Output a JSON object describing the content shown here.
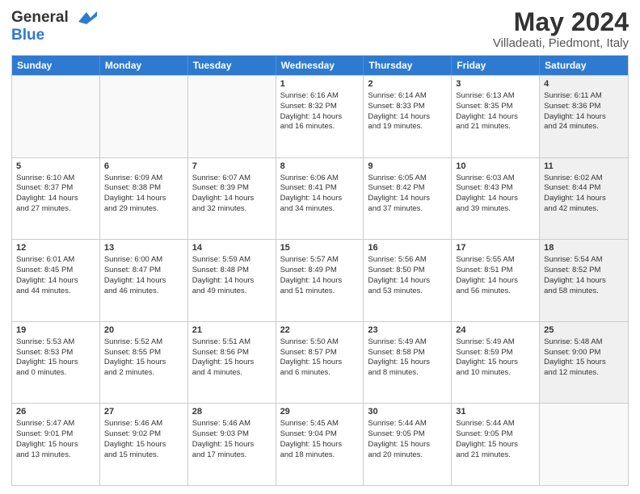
{
  "header": {
    "logo_line1": "General",
    "logo_line2": "Blue",
    "title": "May 2024",
    "subtitle": "Villadeati, Piedmont, Italy"
  },
  "calendar": {
    "days": [
      "Sunday",
      "Monday",
      "Tuesday",
      "Wednesday",
      "Thursday",
      "Friday",
      "Saturday"
    ],
    "rows": [
      [
        {
          "num": "",
          "lines": [],
          "empty": true
        },
        {
          "num": "",
          "lines": [],
          "empty": true
        },
        {
          "num": "",
          "lines": [],
          "empty": true
        },
        {
          "num": "1",
          "lines": [
            "Sunrise: 6:16 AM",
            "Sunset: 8:32 PM",
            "Daylight: 14 hours",
            "and 16 minutes."
          ],
          "shaded": false
        },
        {
          "num": "2",
          "lines": [
            "Sunrise: 6:14 AM",
            "Sunset: 8:33 PM",
            "Daylight: 14 hours",
            "and 19 minutes."
          ],
          "shaded": false
        },
        {
          "num": "3",
          "lines": [
            "Sunrise: 6:13 AM",
            "Sunset: 8:35 PM",
            "Daylight: 14 hours",
            "and 21 minutes."
          ],
          "shaded": false
        },
        {
          "num": "4",
          "lines": [
            "Sunrise: 6:11 AM",
            "Sunset: 8:36 PM",
            "Daylight: 14 hours",
            "and 24 minutes."
          ],
          "shaded": true
        }
      ],
      [
        {
          "num": "5",
          "lines": [
            "Sunrise: 6:10 AM",
            "Sunset: 8:37 PM",
            "Daylight: 14 hours",
            "and 27 minutes."
          ],
          "shaded": false
        },
        {
          "num": "6",
          "lines": [
            "Sunrise: 6:09 AM",
            "Sunset: 8:38 PM",
            "Daylight: 14 hours",
            "and 29 minutes."
          ],
          "shaded": false
        },
        {
          "num": "7",
          "lines": [
            "Sunrise: 6:07 AM",
            "Sunset: 8:39 PM",
            "Daylight: 14 hours",
            "and 32 minutes."
          ],
          "shaded": false
        },
        {
          "num": "8",
          "lines": [
            "Sunrise: 6:06 AM",
            "Sunset: 8:41 PM",
            "Daylight: 14 hours",
            "and 34 minutes."
          ],
          "shaded": false
        },
        {
          "num": "9",
          "lines": [
            "Sunrise: 6:05 AM",
            "Sunset: 8:42 PM",
            "Daylight: 14 hours",
            "and 37 minutes."
          ],
          "shaded": false
        },
        {
          "num": "10",
          "lines": [
            "Sunrise: 6:03 AM",
            "Sunset: 8:43 PM",
            "Daylight: 14 hours",
            "and 39 minutes."
          ],
          "shaded": false
        },
        {
          "num": "11",
          "lines": [
            "Sunrise: 6:02 AM",
            "Sunset: 8:44 PM",
            "Daylight: 14 hours",
            "and 42 minutes."
          ],
          "shaded": true
        }
      ],
      [
        {
          "num": "12",
          "lines": [
            "Sunrise: 6:01 AM",
            "Sunset: 8:45 PM",
            "Daylight: 14 hours",
            "and 44 minutes."
          ],
          "shaded": false
        },
        {
          "num": "13",
          "lines": [
            "Sunrise: 6:00 AM",
            "Sunset: 8:47 PM",
            "Daylight: 14 hours",
            "and 46 minutes."
          ],
          "shaded": false
        },
        {
          "num": "14",
          "lines": [
            "Sunrise: 5:59 AM",
            "Sunset: 8:48 PM",
            "Daylight: 14 hours",
            "and 49 minutes."
          ],
          "shaded": false
        },
        {
          "num": "15",
          "lines": [
            "Sunrise: 5:57 AM",
            "Sunset: 8:49 PM",
            "Daylight: 14 hours",
            "and 51 minutes."
          ],
          "shaded": false
        },
        {
          "num": "16",
          "lines": [
            "Sunrise: 5:56 AM",
            "Sunset: 8:50 PM",
            "Daylight: 14 hours",
            "and 53 minutes."
          ],
          "shaded": false
        },
        {
          "num": "17",
          "lines": [
            "Sunrise: 5:55 AM",
            "Sunset: 8:51 PM",
            "Daylight: 14 hours",
            "and 56 minutes."
          ],
          "shaded": false
        },
        {
          "num": "18",
          "lines": [
            "Sunrise: 5:54 AM",
            "Sunset: 8:52 PM",
            "Daylight: 14 hours",
            "and 58 minutes."
          ],
          "shaded": true
        }
      ],
      [
        {
          "num": "19",
          "lines": [
            "Sunrise: 5:53 AM",
            "Sunset: 8:53 PM",
            "Daylight: 15 hours",
            "and 0 minutes."
          ],
          "shaded": false
        },
        {
          "num": "20",
          "lines": [
            "Sunrise: 5:52 AM",
            "Sunset: 8:55 PM",
            "Daylight: 15 hours",
            "and 2 minutes."
          ],
          "shaded": false
        },
        {
          "num": "21",
          "lines": [
            "Sunrise: 5:51 AM",
            "Sunset: 8:56 PM",
            "Daylight: 15 hours",
            "and 4 minutes."
          ],
          "shaded": false
        },
        {
          "num": "22",
          "lines": [
            "Sunrise: 5:50 AM",
            "Sunset: 8:57 PM",
            "Daylight: 15 hours",
            "and 6 minutes."
          ],
          "shaded": false
        },
        {
          "num": "23",
          "lines": [
            "Sunrise: 5:49 AM",
            "Sunset: 8:58 PM",
            "Daylight: 15 hours",
            "and 8 minutes."
          ],
          "shaded": false
        },
        {
          "num": "24",
          "lines": [
            "Sunrise: 5:49 AM",
            "Sunset: 8:59 PM",
            "Daylight: 15 hours",
            "and 10 minutes."
          ],
          "shaded": false
        },
        {
          "num": "25",
          "lines": [
            "Sunrise: 5:48 AM",
            "Sunset: 9:00 PM",
            "Daylight: 15 hours",
            "and 12 minutes."
          ],
          "shaded": true
        }
      ],
      [
        {
          "num": "26",
          "lines": [
            "Sunrise: 5:47 AM",
            "Sunset: 9:01 PM",
            "Daylight: 15 hours",
            "and 13 minutes."
          ],
          "shaded": false
        },
        {
          "num": "27",
          "lines": [
            "Sunrise: 5:46 AM",
            "Sunset: 9:02 PM",
            "Daylight: 15 hours",
            "and 15 minutes."
          ],
          "shaded": false
        },
        {
          "num": "28",
          "lines": [
            "Sunrise: 5:46 AM",
            "Sunset: 9:03 PM",
            "Daylight: 15 hours",
            "and 17 minutes."
          ],
          "shaded": false
        },
        {
          "num": "29",
          "lines": [
            "Sunrise: 5:45 AM",
            "Sunset: 9:04 PM",
            "Daylight: 15 hours",
            "and 18 minutes."
          ],
          "shaded": false
        },
        {
          "num": "30",
          "lines": [
            "Sunrise: 5:44 AM",
            "Sunset: 9:05 PM",
            "Daylight: 15 hours",
            "and 20 minutes."
          ],
          "shaded": false
        },
        {
          "num": "31",
          "lines": [
            "Sunrise: 5:44 AM",
            "Sunset: 9:05 PM",
            "Daylight: 15 hours",
            "and 21 minutes."
          ],
          "shaded": false
        },
        {
          "num": "",
          "lines": [],
          "empty": true,
          "shaded": true
        }
      ]
    ]
  }
}
